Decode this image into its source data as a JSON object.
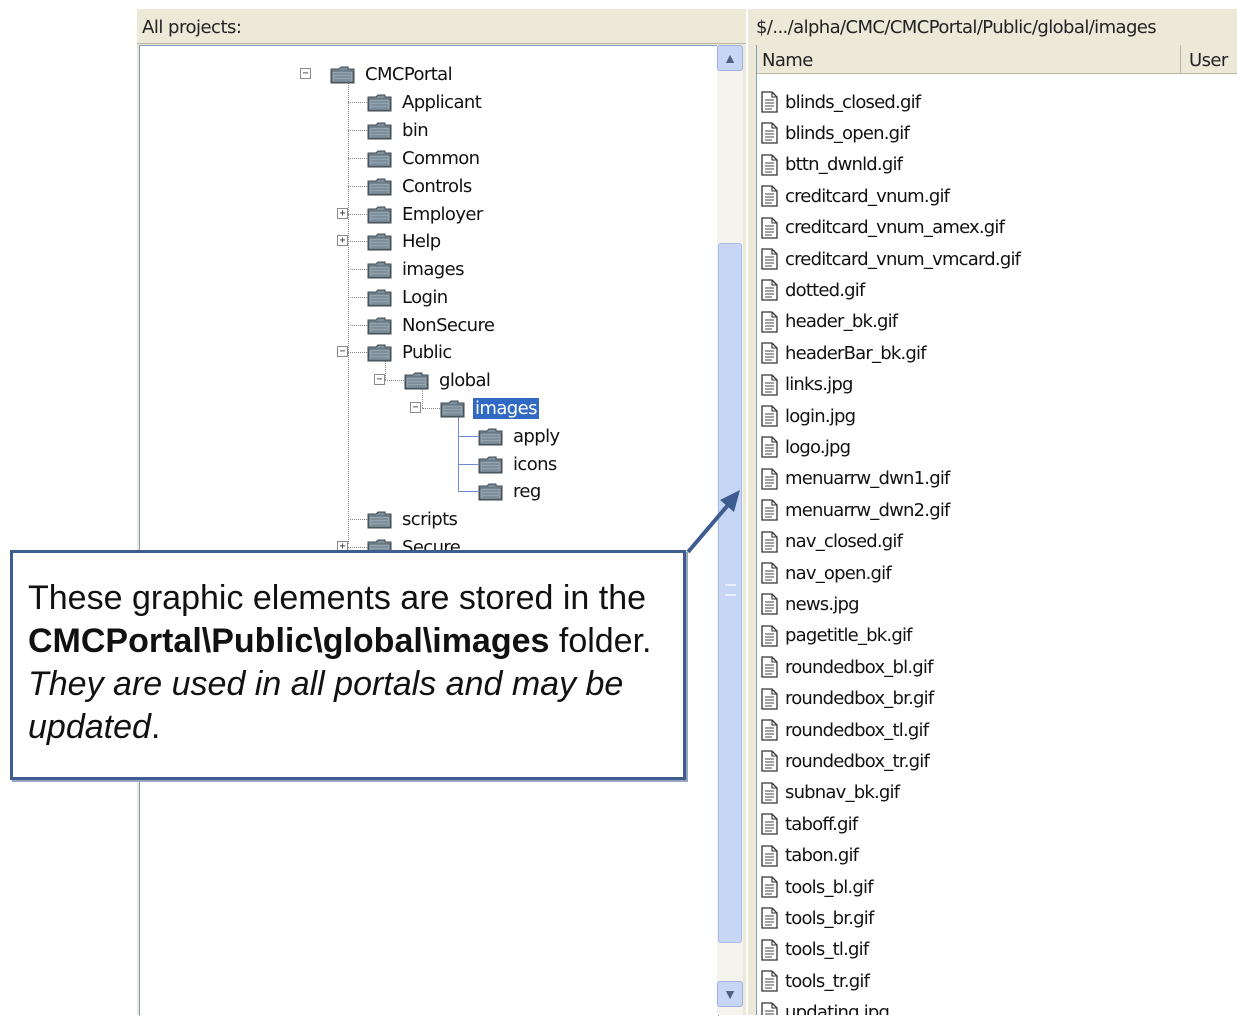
{
  "left_pane": {
    "header": "All projects:",
    "tree": [
      {
        "label": "CMCPortal",
        "expander": "−"
      },
      {
        "label": "Applicant"
      },
      {
        "label": "bin"
      },
      {
        "label": "Common"
      },
      {
        "label": "Controls"
      },
      {
        "label": "Employer",
        "expander": "+"
      },
      {
        "label": "Help",
        "expander": "+"
      },
      {
        "label": "images"
      },
      {
        "label": "Login"
      },
      {
        "label": "NonSecure"
      },
      {
        "label": "Public",
        "expander": "−"
      },
      {
        "label": "global",
        "expander": "−"
      },
      {
        "label": "images",
        "expander": "−",
        "selected": true
      },
      {
        "label": "apply"
      },
      {
        "label": "icons"
      },
      {
        "label": "reg"
      },
      {
        "label": "scripts"
      },
      {
        "label": "Secure",
        "expander": "+"
      }
    ]
  },
  "right_pane": {
    "path": "$/.../alpha/CMC/CMCPortal/Public/global/images",
    "columns": {
      "name": "Name",
      "user": "User"
    },
    "files": [
      "blinds_closed.gif",
      "blinds_open.gif",
      "bttn_dwnld.gif",
      "creditcard_vnum.gif",
      "creditcard_vnum_amex.gif",
      "creditcard_vnum_vmcard.gif",
      "dotted.gif",
      "header_bk.gif",
      "headerBar_bk.gif",
      "links.jpg",
      "login.jpg",
      "logo.jpg",
      "menuarrw_dwn1.gif",
      "menuarrw_dwn2.gif",
      "nav_closed.gif",
      "nav_open.gif",
      "news.jpg",
      "pagetitle_bk.gif",
      "roundedbox_bl.gif",
      "roundedbox_br.gif",
      "roundedbox_tl.gif",
      "roundedbox_tr.gif",
      "subnav_bk.gif",
      "taboff.gif",
      "tabon.gif",
      "tools_bl.gif",
      "tools_br.gif",
      "tools_tl.gif",
      "tools_tr.gif",
      "updating.jpg"
    ]
  },
  "scrollbar": {
    "up": "▲",
    "down": "▼"
  },
  "callout": {
    "part1": "These graphic elements are stored in the ",
    "bold": "CMCPortal\\Public\\global\\images",
    "part2": " folder. ",
    "italic": "They are used in all portals and may be updated",
    "part3": "."
  },
  "colors": {
    "selection": "#316ac5",
    "callout_border": "#3d5c8f",
    "folder": "#6b7f8f"
  }
}
